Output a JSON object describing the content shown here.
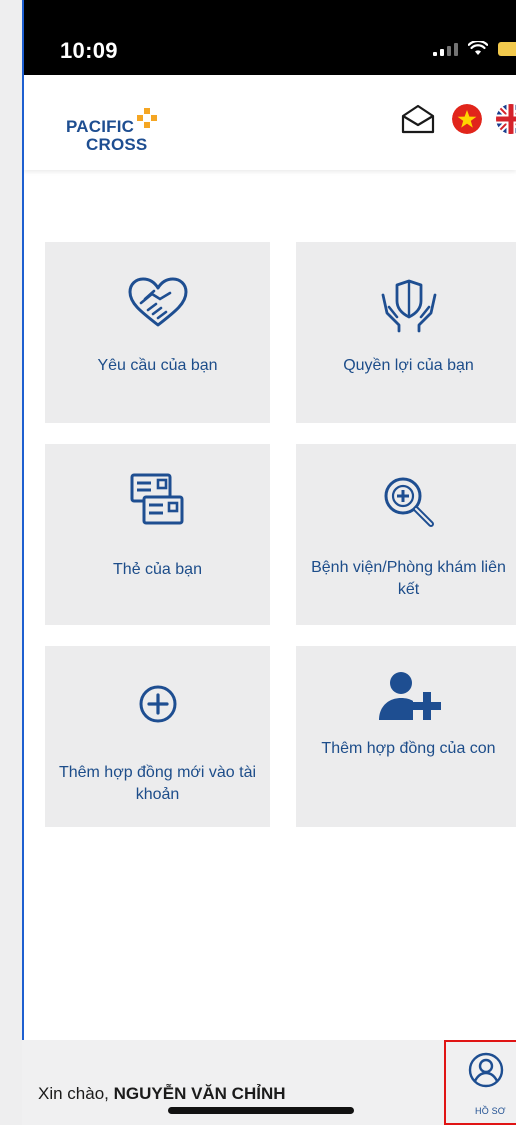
{
  "status_bar": {
    "time": "10:09"
  },
  "header": {
    "logo_line1": "PACIFIC",
    "logo_line2": "CROSS"
  },
  "cards": [
    {
      "label": "Yêu cầu của bạn",
      "icon": "handshake-heart-icon"
    },
    {
      "label": "Quyền lợi của bạn",
      "icon": "shield-hands-icon"
    },
    {
      "label": "Thẻ của bạn",
      "icon": "cards-icon"
    },
    {
      "label": "Bệnh viện/Phòng khám liên kết",
      "icon": "medical-search-icon"
    },
    {
      "label": "Thêm hợp đồng mới vào tài khoản",
      "icon": "plus-circle-icon"
    },
    {
      "label": "Thêm hợp đồng của con",
      "icon": "add-user-icon"
    }
  ],
  "footer": {
    "greeting_prefix": "Xin chào, ",
    "user_name": "NGUYỄN VĂN CHỈNH",
    "profile_label": "HỒ SƠ"
  },
  "colors": {
    "brand_blue": "#1e4e91",
    "card_bg": "#ececed",
    "highlight_red": "#e01414"
  }
}
